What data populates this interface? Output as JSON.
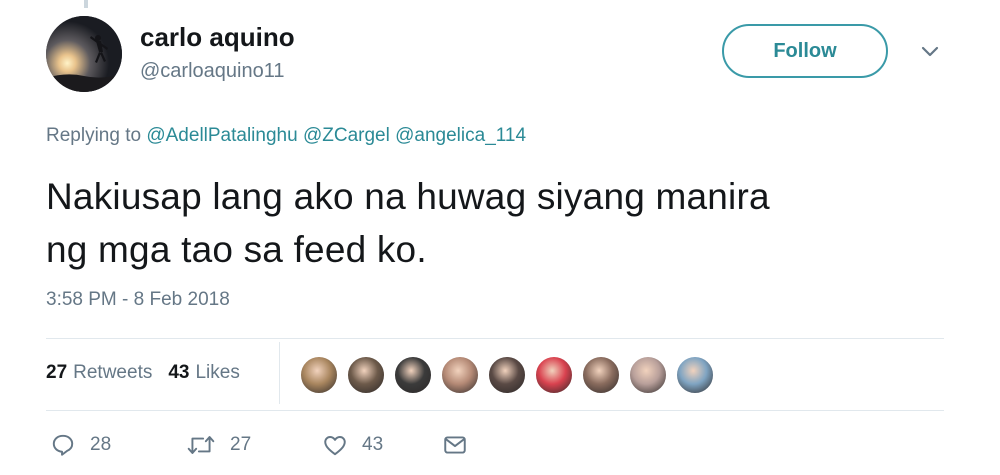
{
  "author": {
    "display_name": "carlo aquino",
    "handle": "@carloaquino11"
  },
  "follow_label": "Follow",
  "reply_context": {
    "prefix": "Replying to",
    "mentions": [
      "@AdellPatalinghu",
      "@ZCargel",
      "@angelica_114"
    ]
  },
  "tweet": {
    "text_line1": "Nakiusap lang ako na huwag siyang manira",
    "text_line2": "ng mga tao sa feed ko.",
    "timestamp": "3:58 PM - 8 Feb 2018"
  },
  "stats": {
    "retweets_count": "27",
    "retweets_label": "Retweets",
    "likes_count": "43",
    "likes_label": "Likes"
  },
  "liker_avatars": [
    {
      "name": "liker-avatar-1",
      "color": "#a9865f"
    },
    {
      "name": "liker-avatar-2",
      "color": "#6d5a4a"
    },
    {
      "name": "liker-avatar-3",
      "color": "#3b3b3b"
    },
    {
      "name": "liker-avatar-4",
      "color": "#b58a76"
    },
    {
      "name": "liker-avatar-5",
      "color": "#5a4a45"
    },
    {
      "name": "liker-avatar-6",
      "color": "#d9424f"
    },
    {
      "name": "liker-avatar-7",
      "color": "#8a6c5e"
    },
    {
      "name": "liker-avatar-8",
      "color": "#b89f9a"
    },
    {
      "name": "liker-avatar-9",
      "color": "#7fa4c2"
    }
  ],
  "actions": {
    "reply_count": "28",
    "retweet_count": "27",
    "like_count": "43"
  },
  "colors": {
    "accent": "#2b8a96",
    "secondary_text": "#657786",
    "primary_text": "#14171a",
    "divider": "#e1e8ed"
  },
  "icons": {
    "reply": "reply-icon",
    "retweet": "retweet-icon",
    "like": "heart-icon",
    "dm": "envelope-icon",
    "more": "chevron-down-icon"
  }
}
